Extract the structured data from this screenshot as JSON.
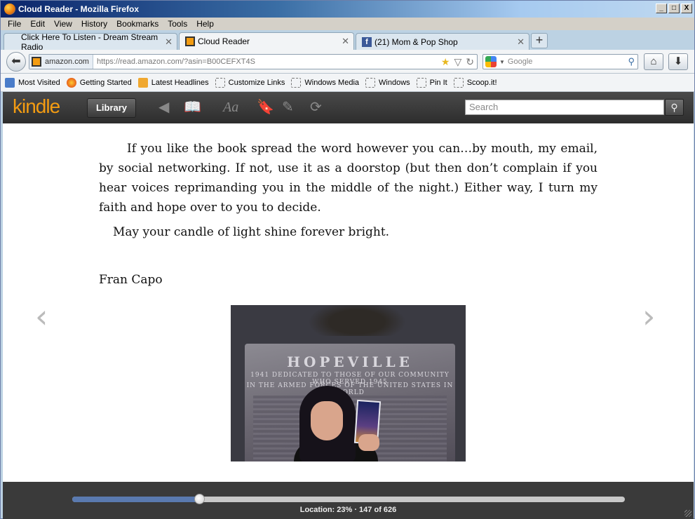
{
  "window": {
    "title": "Cloud Reader - Mozilla Firefox",
    "controls": [
      "_",
      "□",
      "X"
    ]
  },
  "menu": [
    "File",
    "Edit",
    "View",
    "History",
    "Bookmarks",
    "Tools",
    "Help"
  ],
  "tabs": [
    {
      "label": "Click Here To Listen - Dream Stream Radio",
      "active": false
    },
    {
      "label": "Cloud Reader",
      "active": true
    },
    {
      "label": "(21) Mom & Pop Shop",
      "active": false
    }
  ],
  "navbar": {
    "site_badge": "amazon.com",
    "url": "https://read.amazon.com/?asin=B00CEFXT4S",
    "search_placeholder": "Google"
  },
  "bookmarks": [
    "Most Visited",
    "Getting Started",
    "Latest Headlines",
    "Customize Links",
    "Windows Media",
    "Windows",
    "Pin It",
    "Scoop.it!"
  ],
  "kindle": {
    "logo": "kindle",
    "library_label": "Library",
    "search_placeholder": "Search",
    "font_icon_text": "Aa"
  },
  "book": {
    "paragraph1": "If you like the book spread the word however you can…by mouth, my email, by social networking. If not, use it as a doorstop (but then don’t complain if you hear voices reprimanding you in the middle of the night.) Either way, I turn my faith and hope over to you to decide.",
    "paragraph2": "May your candle of light shine forever bright.",
    "signature": "Fran Capo"
  },
  "photo": {
    "plaque_title": "HOPEVILLE",
    "plaque_line1": "1941    DEDICATED TO THOSE OF OUR COMMUNITY WHO SERVED    1945",
    "plaque_line2": "IN THE ARMED FORCES OF THE UNITED STATES IN WORLD"
  },
  "progress": {
    "percent": 23,
    "location_text": "Location: 23% · 147 of 626"
  }
}
